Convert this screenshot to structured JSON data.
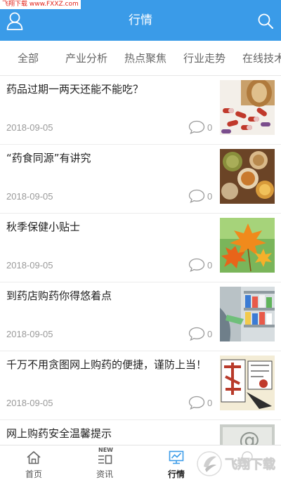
{
  "watermark_top": "飞翔下载 www.FXXZ.com",
  "header": {
    "title": "行情",
    "user_icon": "user-icon",
    "search_icon": "search-icon"
  },
  "tabs": [
    "全部",
    "产业分析",
    "热点聚焦",
    "行业走势",
    "在线技术"
  ],
  "articles": [
    {
      "title": "药品过期一两天还能不能吃？",
      "date": "2018-09-05",
      "comments": "0",
      "thumb": "pills"
    },
    {
      "title": "“药食同源”有讲究",
      "date": "2018-09-05",
      "comments": "0",
      "thumb": "herbs"
    },
    {
      "title": "秋季保健小贴士",
      "date": "2018-09-05",
      "comments": "0",
      "thumb": "maple-leaves"
    },
    {
      "title": "到药店购药你得悠着点",
      "date": "2018-09-05",
      "comments": "0",
      "thumb": "pharmacy-shelf"
    },
    {
      "title": "千万不用贪图网上购药的便捷，谨防上当！",
      "date": "2018-09-05",
      "comments": "0",
      "thumb": "online-pharmacy"
    },
    {
      "title": "网上购药安全温馨提示",
      "date": "",
      "comments": "",
      "thumb": "email-keyboard"
    }
  ],
  "bottom_nav": [
    {
      "label": "首页",
      "icon": "home-icon",
      "active": false
    },
    {
      "label": "资讯",
      "icon": "news-icon",
      "badge": "NEW",
      "active": false
    },
    {
      "label": "行情",
      "icon": "market-icon",
      "active": true
    },
    {
      "label": "",
      "icon": "overlay-icon",
      "active": false
    },
    {
      "label": "",
      "icon": "overlay-icon",
      "active": false
    }
  ],
  "watermark_bottom": "飞翔下载",
  "colors": {
    "header": "#3a9be8",
    "active_tab_icon": "#3a9be8"
  }
}
